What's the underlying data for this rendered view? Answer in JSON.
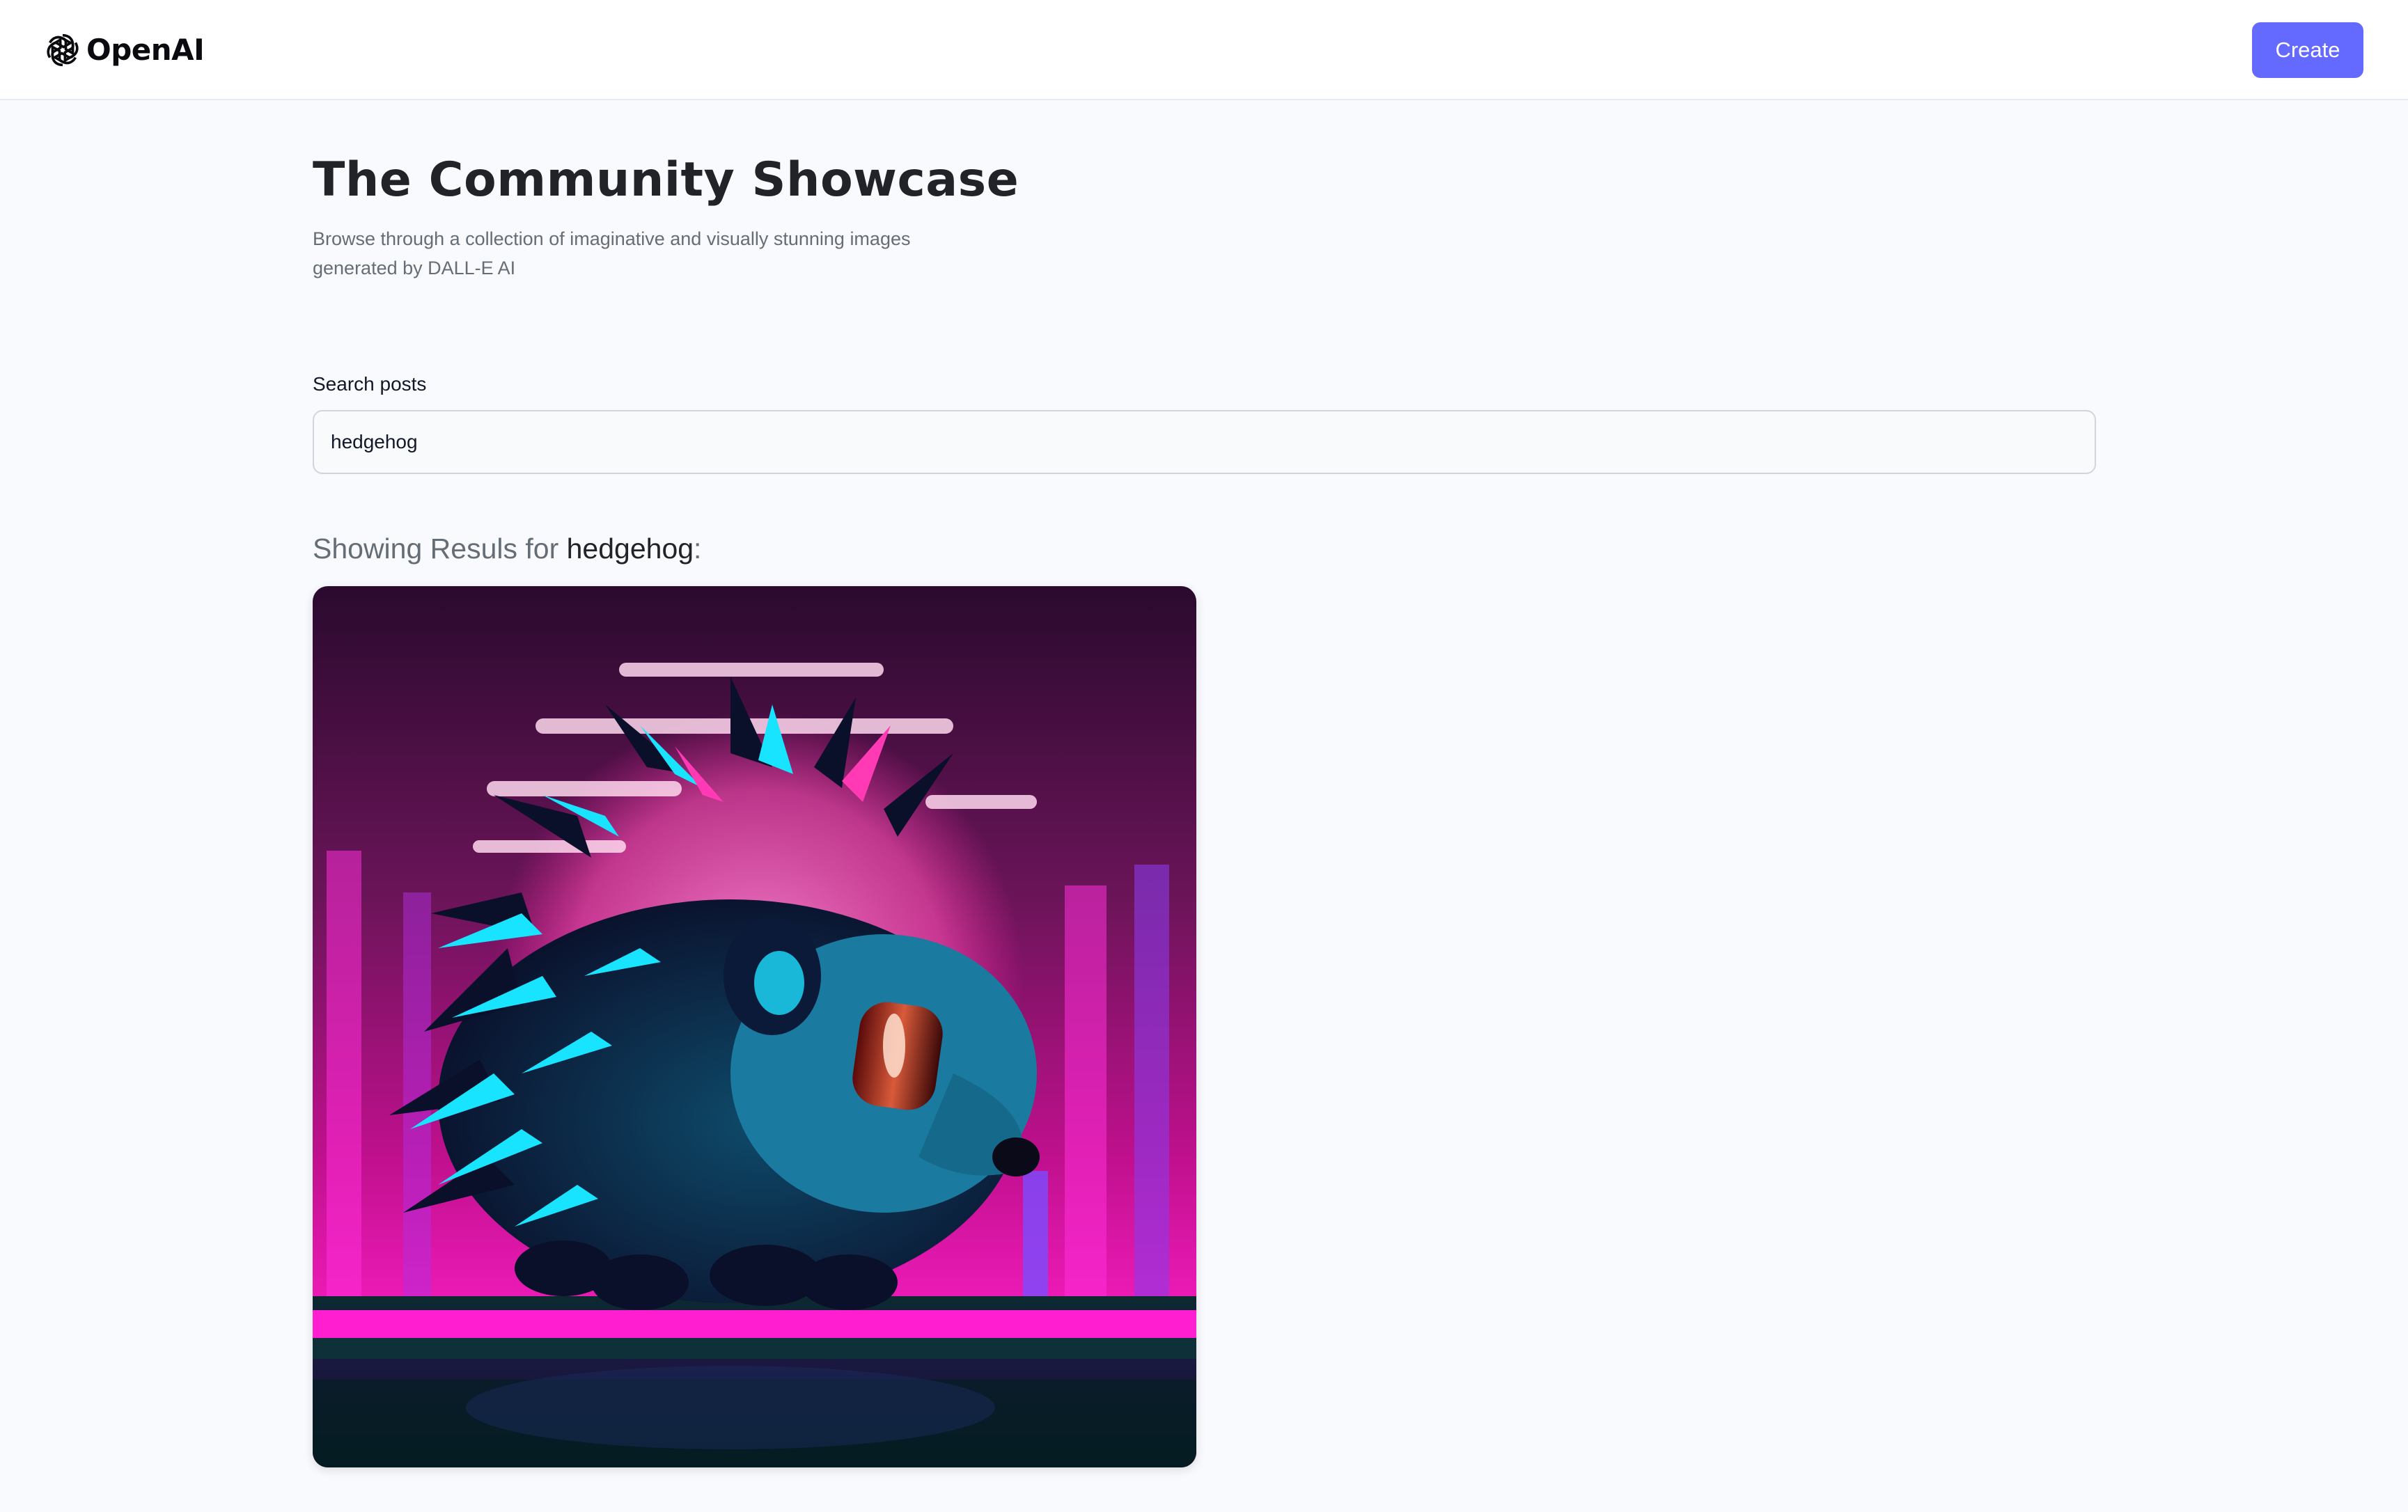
{
  "header": {
    "logo_text": "OpenAI",
    "logo_icon": "openai-logo-icon",
    "create_label": "Create"
  },
  "hero": {
    "title": "The Community Showcase",
    "subtitle": "Browse through a collection of imaginative and visually stunning images generated by DALL-E AI"
  },
  "search": {
    "label": "Search posts",
    "value": "hedgehog"
  },
  "results": {
    "prefix": "Showing Resuls for ",
    "query": "hedgehog",
    "suffix": ":",
    "cards": [
      {
        "image": "synthwave-hedgehog-image"
      }
    ]
  },
  "colors": {
    "accent": "#6469ff",
    "page_background": "#f9fafe",
    "title_text": "#222328",
    "muted_text": "#666e75"
  }
}
